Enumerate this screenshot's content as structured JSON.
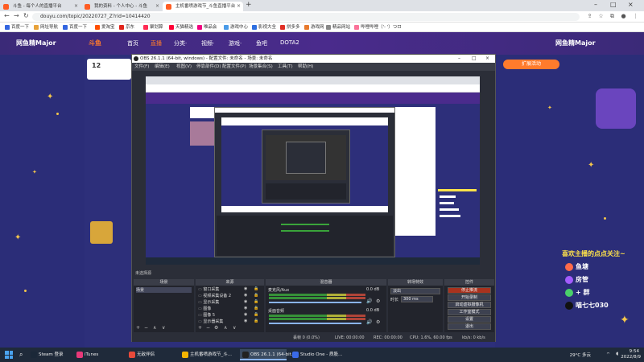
{
  "browser": {
    "tabs": [
      {
        "label": "斗鱼 - 每个人的直播平台"
      },
      {
        "label": "我的资料 - 个人中心 - 斗鱼"
      },
      {
        "label": "主机番喷游戏节_斗鱼直播平台"
      }
    ],
    "url": "douyu.com/topic/20220727_Z?rid=10414420",
    "bookmarks": [
      {
        "label": "百度一下",
        "color": "#3466e0"
      },
      {
        "label": "网址导航",
        "color": "#e8a23a"
      },
      {
        "label": "百度一下",
        "color": "#3466e0"
      },
      {
        "label": "爱淘宝",
        "color": "#ff5000"
      },
      {
        "label": "京东",
        "color": "#e1251b"
      },
      {
        "label": "聚划算",
        "color": "#ff2c54"
      },
      {
        "label": "天猫精选",
        "color": "#ff0036"
      },
      {
        "label": "唯品会",
        "color": "#f10180"
      },
      {
        "label": "游戏中心",
        "color": "#4a9be8"
      },
      {
        "label": "影视大全",
        "color": "#2e6fe0"
      },
      {
        "label": "拼多多",
        "color": "#e02e24"
      },
      {
        "label": "游戏网",
        "color": "#e87a2e"
      },
      {
        "label": "精品网站",
        "color": "#888"
      },
      {
        "label": "哔哩哔哩（'- '）つロ",
        "color": "#fb7299"
      }
    ]
  },
  "site": {
    "logo_left": "网鱼精Major",
    "logo_right": "网鱼精Major",
    "brand": "斗鱼",
    "nav": [
      "首页",
      "直播",
      "分类·",
      "视频·",
      "游戏·",
      "鱼吧",
      "DOTA2"
    ],
    "room_number": "12",
    "gift_button": "扩展活动",
    "follow": {
      "title": "喜欢主播的点点关注~",
      "rows": [
        "鱼塘",
        "房管",
        "+ 群",
        "喵七七030"
      ]
    }
  },
  "obs": {
    "title": "OBS 26.1.1 (64-bit, windows) - 配置文件: 未命名 - 场景: 未命名",
    "menu": [
      "文件(F)",
      "编辑(E)",
      "视图(V)",
      "停靠部件(D)",
      "配置文件(P)",
      "场景集合(S)",
      "工具(T)",
      "帮助(H)"
    ],
    "no_source": "未选择源",
    "scenes_header": "场景",
    "scene_item": "场景",
    "sources_header": "来源",
    "sources": [
      "窗口采集",
      "视频采集设备 2",
      "显示采集",
      "图像",
      "图像 5",
      "显示器采集"
    ],
    "mixer_header": "混音器",
    "mixer": [
      {
        "name": "麦克风/Aux",
        "db": "0.0 dB"
      },
      {
        "name": "桌面音频",
        "db": "0.0 dB"
      }
    ],
    "transition_header": "转场特效",
    "transition": {
      "type": "淡出",
      "duration_label": "时长",
      "duration": "300 ms"
    },
    "controls_header": "控件",
    "controls": [
      "停止推流",
      "开始录制",
      "启动虚拟摄像机",
      "工作室模式",
      "设置",
      "退出"
    ],
    "status": {
      "dropped": "丢帧 0 (0.0%)",
      "live": "LIVE: 00:00:00",
      "rec": "REC: 00:00:00",
      "cpu": "CPU: 1.6%, 60.00 fps",
      "kbps": "kb/s: 0 kb/s"
    }
  },
  "taskbar": {
    "items": [
      {
        "label": "Steam 登录",
        "color": "#1b2838"
      },
      {
        "label": "iTunes",
        "color": "#e8397a"
      },
      {
        "label": "无敌伴侣",
        "color": "#e84a3a"
      },
      {
        "label": "主机番喷游戏节_斗...",
        "color": "#f4b400"
      },
      {
        "label": "OBS 26.1.1 (64-bit...",
        "color": "#222"
      },
      {
        "label": "Studio One - 质股...",
        "color": "#3a6ae8"
      }
    ],
    "weather": "29°C 多云",
    "time": "9:54",
    "date": "2022/8/9"
  }
}
